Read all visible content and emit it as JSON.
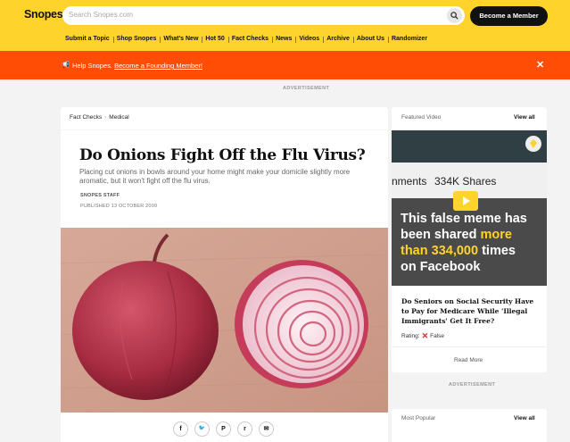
{
  "header": {
    "logo": "Snopes",
    "search_placeholder": "Search Snopes.com",
    "member_button": "Become a Member",
    "nav": [
      "Submit a Topic",
      "Shop Snopes",
      "What's New",
      "Hot 50",
      "Fact Checks",
      "News",
      "Videos",
      "Archive",
      "About Us",
      "Randomizer"
    ]
  },
  "banner": {
    "prefix": "Help Snopes.",
    "link": "Become a Founding Member!",
    "close": "✕"
  },
  "ads": {
    "top_label": "ADVERTISEMENT",
    "side_label": "ADVERTISEMENT"
  },
  "article": {
    "breadcrumb": [
      "Fact Checks",
      "Medical"
    ],
    "breadcrumb_sep": "›",
    "title": "Do Onions Fight Off the Flu Virus?",
    "subtitle": "Placing cut onions in bowls around your home might make your domicile slightly more aromatic, but it won't fight off the flu virus.",
    "byline": "SNOPES STAFF",
    "published": "PUBLISHED 13 OCTOBER 2009",
    "share": [
      {
        "icon": "facebook-icon",
        "glyph": "f"
      },
      {
        "icon": "twitter-icon",
        "glyph": "🐦"
      },
      {
        "icon": "pinterest-icon",
        "glyph": "P"
      },
      {
        "icon": "reddit-icon",
        "glyph": "r"
      },
      {
        "icon": "email-icon",
        "glyph": "✉"
      }
    ]
  },
  "sidebar": {
    "featured_video_label": "Featured Video",
    "view_all": "View all",
    "video": {
      "top_left": "nments",
      "top_right": "334K Shares",
      "line1": "This false meme has",
      "line2a": "been shared ",
      "line2b": "more",
      "line3a": "than 334,000",
      "line3b": " times",
      "line4": "on Facebook"
    },
    "article_title": "Do Seniors on Social Security Have to Pay for Medicare While 'Illegal Immigrants' Get It Free?",
    "rating_label": "Rating:",
    "rating_value": "False",
    "read_more": "Read More",
    "most_popular_label": "Most Popular",
    "most_popular_view_all": "View all"
  },
  "colors": {
    "brand_yellow": "#fed32c",
    "banner_orange": "#ff4d05",
    "false_red": "#d62b2b"
  }
}
